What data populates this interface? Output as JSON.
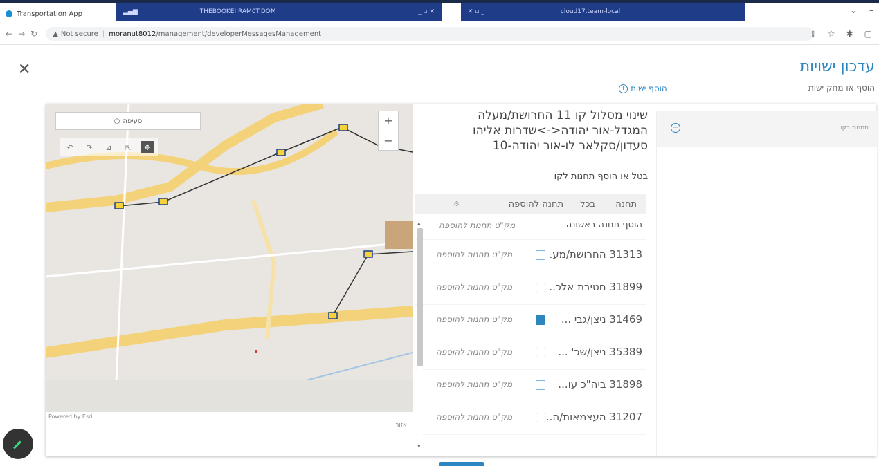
{
  "browser": {
    "tab_title": "Transportation App",
    "rdp_title_1": "THEBOOKEI.RAM0T.DOM",
    "rdp_title_2": "cloud17.team-local",
    "url_secure": "Not secure",
    "url_host": "moranut8012",
    "url_path": "/management/developerMessagesManagement"
  },
  "page": {
    "title": "עדכון ישויות",
    "subtitle": "הוסף או מחק ישות",
    "add_entity": "הוסף ישות",
    "close_icon": "close-icon"
  },
  "right_panel": {
    "row_label": "תחנות בקו"
  },
  "map": {
    "search_placeholder": "סעיפה",
    "powered_by": "Powered by Esri",
    "footer_label": "אזור"
  },
  "route": {
    "title": "שינוי מסלול קו 11 החרושת/מעלה המגדל-אור יהודה<->שדרות אליהו סעדון/סקלאר לו-אור יהודה-10",
    "subtitle": "בטל או הוסף תחנות לקו",
    "headers": {
      "station": "תחנה",
      "cancel": "בכל",
      "add": "תחנה להוספה"
    },
    "first_row": {
      "name": "הוסף תחנה ראשונה",
      "hint": "מק\"ט תחנות להוספה"
    },
    "rows": [
      {
        "name": "31313 החרושת/מע.",
        "hint": "מק\"ט תחנות להוספה",
        "checked": false
      },
      {
        "name": "31899 חטיבת אלכ..",
        "hint": "מק\"ט תחנות להוספה",
        "checked": false
      },
      {
        "name": "31469 ניצן/גבי ...",
        "hint": "מק\"ט תחנות להוספה",
        "checked": true
      },
      {
        "name": "35389 ניצן/שכ' ...",
        "hint": "מק\"ט תחנות להוספה",
        "checked": false
      },
      {
        "name": "31898 ביה\"כ עו...",
        "hint": "מק\"ט תחנות להוספה",
        "checked": false
      },
      {
        "name": "31207 העצמאות/ה..",
        "hint": "מק\"ט תחנות להוספה",
        "checked": false
      }
    ]
  }
}
